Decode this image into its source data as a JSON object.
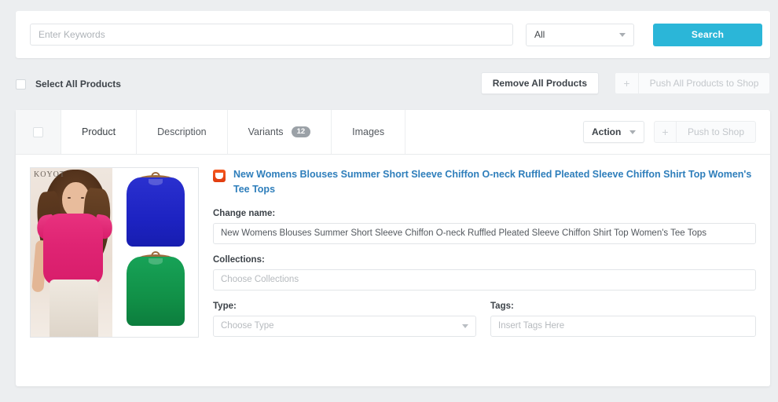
{
  "search": {
    "keywords_placeholder": "Enter Keywords",
    "keywords_value": "",
    "scope_value": "All",
    "scope_caret_icon": "chevron-down-icon",
    "search_button": "Search"
  },
  "action_bar": {
    "select_all_label": "Select All Products",
    "remove_all_button": "Remove All Products",
    "push_all_button": "Push All Products to Shop",
    "plus_icon": "+"
  },
  "card": {
    "tabs": [
      {
        "label": "Product",
        "badge": ""
      },
      {
        "label": "Description",
        "badge": ""
      },
      {
        "label": "Variants",
        "badge": "12"
      },
      {
        "label": "Images",
        "badge": ""
      }
    ],
    "action_dropdown": "Action",
    "action_caret_icon": "chevron-down-icon",
    "push_to_shop": "Push to Shop",
    "plus_icon": "+"
  },
  "product": {
    "source_icon": "shopping-bag-icon",
    "title": "New Womens Blouses Summer Short Sleeve Chiffon O-neck Ruffled Pleated Sleeve Chiffon Shirt Top Women's Tee Tops",
    "image_watermark": "KOYOT",
    "colors": {
      "blouse_pink": "#df2473",
      "blouse_blue": "#1d23c2",
      "blouse_green": "#119047"
    },
    "fields": {
      "change_name_label": "Change name:",
      "change_name_value": "New Womens Blouses Summer Short Sleeve Chiffon O-neck Ruffled Pleated Sleeve Chiffon Shirt Top Women's Tee Tops",
      "collections_label": "Collections:",
      "collections_placeholder": "Choose Collections",
      "collections_value": "",
      "type_label": "Type:",
      "type_placeholder": "Choose Type",
      "tags_label": "Tags:",
      "tags_placeholder": "Insert Tags Here",
      "tags_value": ""
    }
  },
  "theme": {
    "accent": "#2bb6d8",
    "link": "#2e7ebb",
    "page_bg": "#eceef0",
    "badge_bg": "#9ba1a7"
  }
}
